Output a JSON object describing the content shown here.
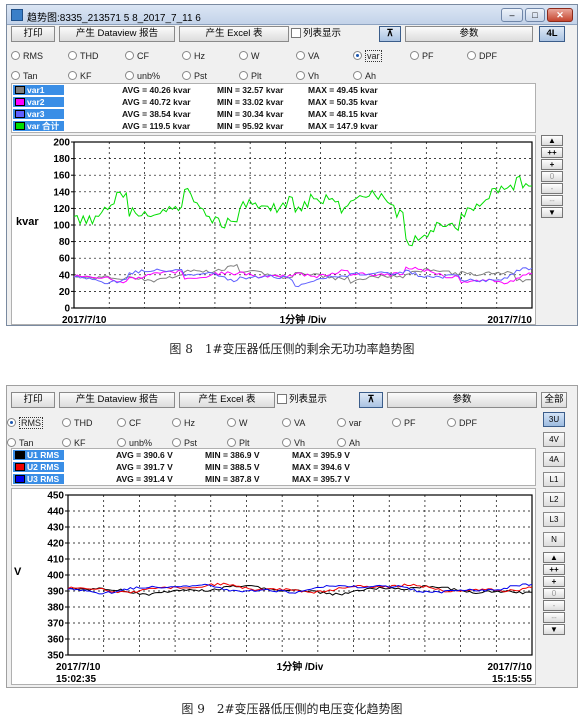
{
  "window1": {
    "title": "趋势图:8335_213571 5 8_2017_7_11 6",
    "win_buttons": [
      "–",
      "□",
      "✕"
    ],
    "toolbar": {
      "print": "打印",
      "dataview_report": "产生 Dataview 报告",
      "excel_table": "产生 Excel 表",
      "list_display": "列表显示",
      "param": "参数",
      "pin_icon_glyph": "⊼",
      "side_top": "4L"
    },
    "radios_row1": [
      "RMS",
      "THD",
      "CF",
      "Hz",
      "W",
      "VA",
      "var",
      "PF",
      "DPF"
    ],
    "radios_row2": [
      "Tan",
      "KF",
      "unb%",
      "Pst",
      "Plt",
      "Vh",
      "Ah"
    ],
    "selected_radio": "var",
    "legend": [
      {
        "name": "var1",
        "color": "#808080",
        "avg": "AVG = 40.26 kvar",
        "min": "MIN = 32.57 kvar",
        "max": "MAX = 49.45 kvar"
      },
      {
        "name": "var2",
        "color": "#ff00ff",
        "avg": "AVG = 40.72 kvar",
        "min": "MIN = 33.02 kvar",
        "max": "MAX = 50.35 kvar"
      },
      {
        "name": "var3",
        "color": "#6060ff",
        "avg": "AVG = 38.54 kvar",
        "min": "MIN = 30.34 kvar",
        "max": "MAX = 48.15 kvar"
      },
      {
        "name": "var 合计",
        "color": "#00dd00",
        "avg": "AVG = 119.5 kvar",
        "min": "MIN = 95.92 kvar",
        "max": "MAX = 147.9 kvar"
      }
    ],
    "side_buttons": [
      "▲",
      "++",
      "+",
      "0",
      "-",
      "--",
      "▼"
    ]
  },
  "chart1": {
    "ylabel": "kvar",
    "y_ticks": [
      "200",
      "180",
      "160",
      "140",
      "120",
      "100",
      "80",
      "60",
      "40",
      "20",
      "0"
    ],
    "xlabel": "1分钟 /Div",
    "start_date": "2017/7/10",
    "end_date": "2017/7/10"
  },
  "caption1": "图 8　1#变压器低压侧的剩余无功功率趋势图",
  "window2": {
    "toolbar": {
      "print": "打印",
      "dataview_report": "产生 Dataview 报告",
      "excel_table": "产生 Excel 表",
      "list_display": "列表显示",
      "param": "参数",
      "pin_icon_glyph": "⊼",
      "all": "全部"
    },
    "radios_row1": [
      "RMS",
      "THD",
      "CF",
      "Hz",
      "W",
      "VA",
      "var",
      "PF",
      "DPF"
    ],
    "radios_row2": [
      "Tan",
      "KF",
      "unb%",
      "Pst",
      "Plt",
      "Vh",
      "Ah"
    ],
    "selected_radio": "RMS",
    "legend": [
      {
        "name": "U1 RMS",
        "color": "#000000",
        "avg": "AVG = 390.6 V",
        "min": "MIN = 386.9 V",
        "max": "MAX = 395.9 V"
      },
      {
        "name": "U2 RMS",
        "color": "#ee0000",
        "avg": "AVG = 391.7 V",
        "min": "MIN = 388.5 V",
        "max": "MAX = 394.6 V"
      },
      {
        "name": "U3 RMS",
        "color": "#0000ee",
        "avg": "AVG = 391.4 V",
        "min": "MIN = 387.8 V",
        "max": "MAX = 395.7 V"
      }
    ],
    "phase_buttons": [
      "3U",
      "4V",
      "4A",
      "L1",
      "L2",
      "L3",
      "N"
    ],
    "side_buttons": [
      "▲",
      "++",
      "+",
      "0",
      "-",
      "--",
      "▼"
    ]
  },
  "chart2": {
    "ylabel": "V",
    "y_ticks": [
      "450",
      "440",
      "430",
      "420",
      "410",
      "400",
      "390",
      "380",
      "370",
      "360",
      "350"
    ],
    "xlabel": "1分钟 /Div",
    "start_date": "2017/7/10",
    "start_time": "15:02:35",
    "end_date": "2017/7/10",
    "end_time": "15:15:55"
  },
  "caption2": "图 9　2#变压器低压侧的电压变化趋势图",
  "chart_data": [
    {
      "type": "line",
      "ylabel": "kvar",
      "xlabel": "1分钟 /Div",
      "ylim": [
        0,
        200
      ],
      "grid": true,
      "series": [
        {
          "name": "var1",
          "color": "#808080",
          "base": 40,
          "amp": 4
        },
        {
          "name": "var2",
          "color": "#ff00ff",
          "base": 40,
          "amp": 4
        },
        {
          "name": "var3",
          "color": "#6060ff",
          "base": 38,
          "amp": 4
        },
        {
          "name": "var 合计",
          "color": "#00dd00",
          "base": 120,
          "amp": 14
        }
      ]
    },
    {
      "type": "line",
      "ylabel": "V",
      "xlabel": "1分钟 /Div",
      "ylim": [
        350,
        450
      ],
      "grid": true,
      "series": [
        {
          "name": "U1 RMS",
          "color": "#000000",
          "base": 390.6,
          "amp": 1.5
        },
        {
          "name": "U2 RMS",
          "color": "#ee0000",
          "base": 391.7,
          "amp": 1.5
        },
        {
          "name": "U3 RMS",
          "color": "#0000ee",
          "base": 391.4,
          "amp": 1.5
        }
      ]
    }
  ]
}
